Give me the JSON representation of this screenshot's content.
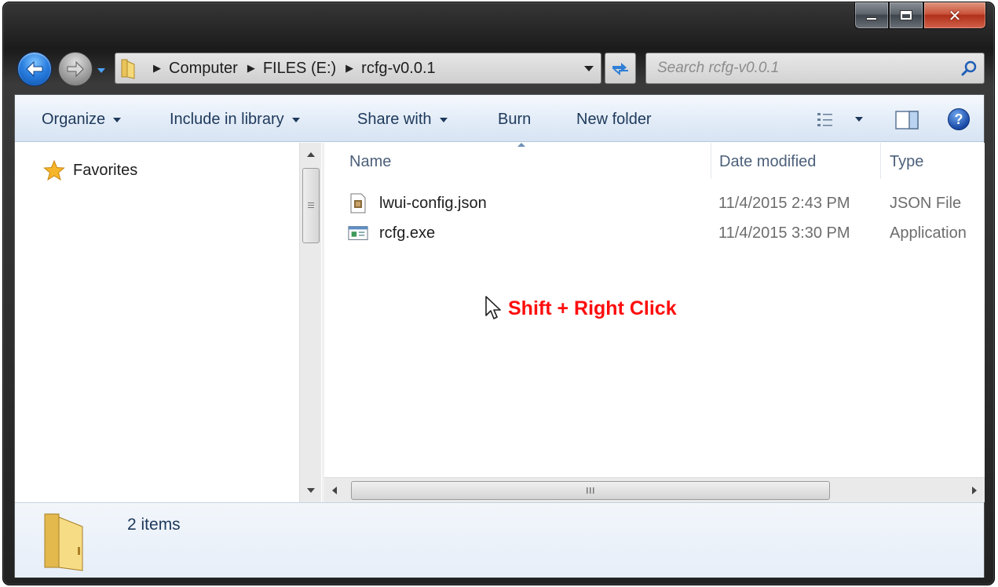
{
  "window": {
    "caption": {
      "minimize_glyph": "–",
      "close_glyph": "✕"
    }
  },
  "address": {
    "breadcrumbs": [
      "Computer",
      "FILES (E:)",
      "rcfg-v0.0.1"
    ]
  },
  "search": {
    "placeholder": "Search rcfg-v0.0.1"
  },
  "toolbar": {
    "organize": "Organize",
    "include_in_library": "Include in library",
    "share_with": "Share with",
    "burn": "Burn",
    "new_folder": "New folder",
    "help_glyph": "?"
  },
  "nav_pane": {
    "favorites": "Favorites"
  },
  "file_list": {
    "columns": {
      "name": "Name",
      "date_modified": "Date modified",
      "type": "Type"
    },
    "rows": [
      {
        "name": "lwui-config.json",
        "date": "11/4/2015 2:43 PM",
        "type": "JSON File",
        "icon": "json-file-icon"
      },
      {
        "name": "rcfg.exe",
        "date": "11/4/2015 3:30 PM",
        "type": "Application",
        "icon": "exe-file-icon"
      }
    ]
  },
  "annotation": {
    "text": "Shift + Right Click",
    "color": "#ff0d0d"
  },
  "details": {
    "item_count": "2 items"
  },
  "colors": {
    "toolbar_text": "#1e395b",
    "header_text": "#4c607a",
    "secondary_text": "#6d6d6d"
  }
}
